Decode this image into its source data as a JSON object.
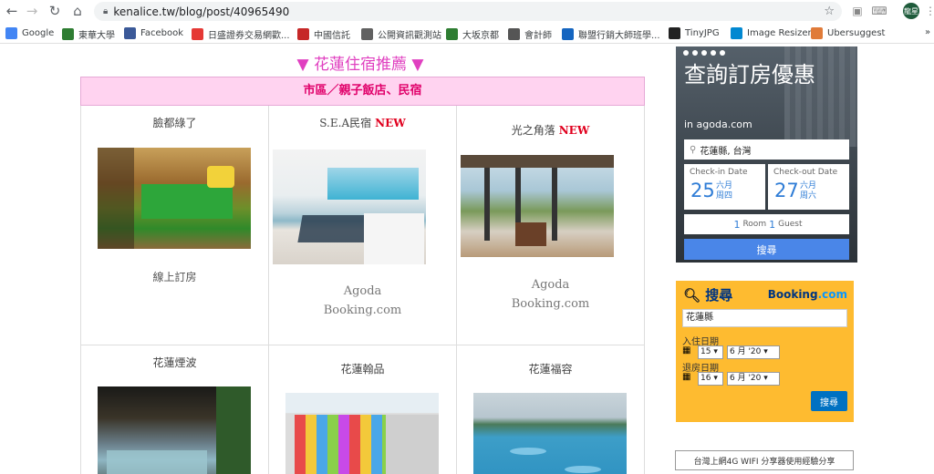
{
  "browser": {
    "url": "kenalice.tw/blog/post/40965490",
    "profile_initials": "龍星"
  },
  "bookmarks": [
    {
      "label": "Google",
      "icon": "google-icon",
      "color": "#4285f4"
    },
    {
      "label": "東華大學",
      "icon": "university-icon",
      "color": "#2e7d32"
    },
    {
      "label": "Facebook",
      "icon": "facebook-icon",
      "color": "#3b5998"
    },
    {
      "label": "日盛證券交易網歡...",
      "icon": "securities-icon",
      "color": "#e53935"
    },
    {
      "label": "中國信託",
      "icon": "bank-icon",
      "color": "#c62828"
    },
    {
      "label": "公開資訊觀測站",
      "icon": "globe-icon",
      "color": "#616161"
    },
    {
      "label": "大坂京都",
      "icon": "plus-icon",
      "color": "#2e7d32"
    },
    {
      "label": "會計師",
      "icon": "calculator-icon",
      "color": "#555"
    },
    {
      "label": "聯盟行銷大師班學...",
      "icon": "course-icon",
      "color": "#1565c0"
    },
    {
      "label": "TinyJPG",
      "icon": "panda-icon",
      "color": "#222"
    },
    {
      "label": "Image Resizer",
      "icon": "resize-icon",
      "color": "#0288d1"
    },
    {
      "label": "Ubersuggest",
      "icon": "avatar-icon",
      "color": "#e07b39"
    }
  ],
  "main_title": "▼ 花蓮住宿推薦 ▼",
  "table_header": "市區／親子飯店、民宿",
  "row1": [
    {
      "title": "臉都綠了",
      "new": "",
      "links": [
        "線上訂房"
      ]
    },
    {
      "title": "S.E.A民宿",
      "new": "NEW",
      "links": [
        "Agoda",
        "Booking.com"
      ]
    },
    {
      "title": "光之角落",
      "new": "NEW",
      "links": [
        "Agoda",
        "Booking.com"
      ]
    }
  ],
  "row2": [
    {
      "title": "花蓮煙波"
    },
    {
      "title": "花蓮翰品"
    },
    {
      "title": "花蓮福容"
    }
  ],
  "agoda": {
    "headline": "查詢訂房優惠",
    "sub": "in agoda.com",
    "destination": "花蓮縣, 台灣",
    "checkin_label": "Check-in Date",
    "checkin_day": "25",
    "checkin_month": "六月",
    "checkin_weekday": "周四",
    "checkout_label": "Check-out Date",
    "checkout_day": "27",
    "checkout_month": "六月",
    "checkout_weekday": "周六",
    "rooms_num": "1",
    "rooms_label": "Room",
    "guests_num": "1",
    "guests_label": "Guest",
    "button": "搜尋"
  },
  "booking": {
    "header": "搜尋",
    "logo_main": "Booking",
    "logo_suffix": ".com",
    "destination": "花蓮縣",
    "checkin_label": "入住日期",
    "checkin_day": "15",
    "checkin_month": "6 月 '20",
    "checkout_label": "退房日期",
    "checkout_day": "16",
    "checkout_month": "6 月 '20",
    "button": "搜尋"
  },
  "sidebar_link": "台灣上網4G WIFI 分享器使用經驗分享"
}
